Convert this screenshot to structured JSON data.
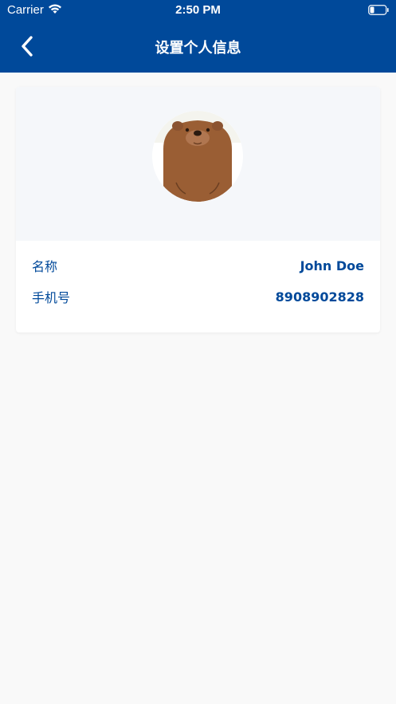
{
  "status_bar": {
    "carrier": "Carrier",
    "time": "2:50 PM",
    "wifi_icon": "wifi-icon",
    "battery_icon": "battery-icon"
  },
  "nav": {
    "title": "设置个人信息",
    "back_icon": "chevron-left-icon"
  },
  "profile": {
    "avatar_icon": "bear-avatar",
    "name_label": "名称",
    "name_value": "John Doe",
    "phone_label": "手机号",
    "phone_value": "8908902828"
  },
  "colors": {
    "primary": "#00499a",
    "background": "#f9f9f9",
    "card": "#ffffff",
    "avatar_bg": "#f5f7fa"
  }
}
